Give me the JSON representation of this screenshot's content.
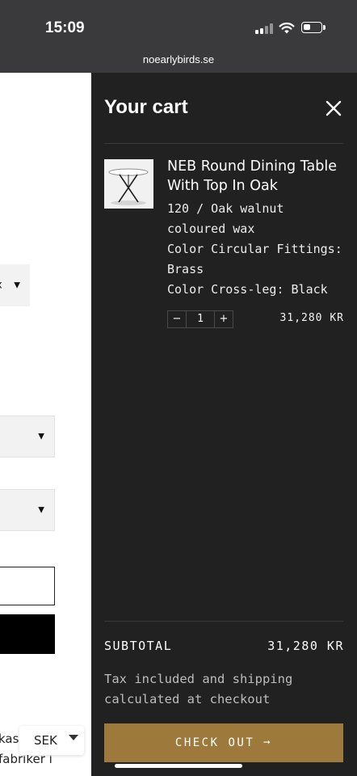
{
  "status_bar": {
    "time": "15:09",
    "url": "noearlybirds.se"
  },
  "background_page": {
    "select_partial_letter": "x",
    "text_line_1": "kas",
    "text_line_2": "fabriker i",
    "currency": "SEK"
  },
  "cart": {
    "title": "Your cart",
    "close_icon": "close-icon",
    "item": {
      "title": "NEB Round Dining Table With Top In Oak",
      "options": [
        "120 / Oak walnut coloured wax",
        "Color Circular Fittings: Brass",
        "Color Cross-leg: Black"
      ],
      "qty_minus": "−",
      "quantity": "1",
      "qty_plus": "+",
      "price": "31,280 KR"
    },
    "subtotal_label": "SUBTOTAL",
    "subtotal_value": "31,280 KR",
    "tax_note": "Tax included and shipping calculated at checkout",
    "checkout_label": "CHECK OUT ➞",
    "accent_color": "#9d7a3b",
    "drawer_color": "#212121"
  }
}
